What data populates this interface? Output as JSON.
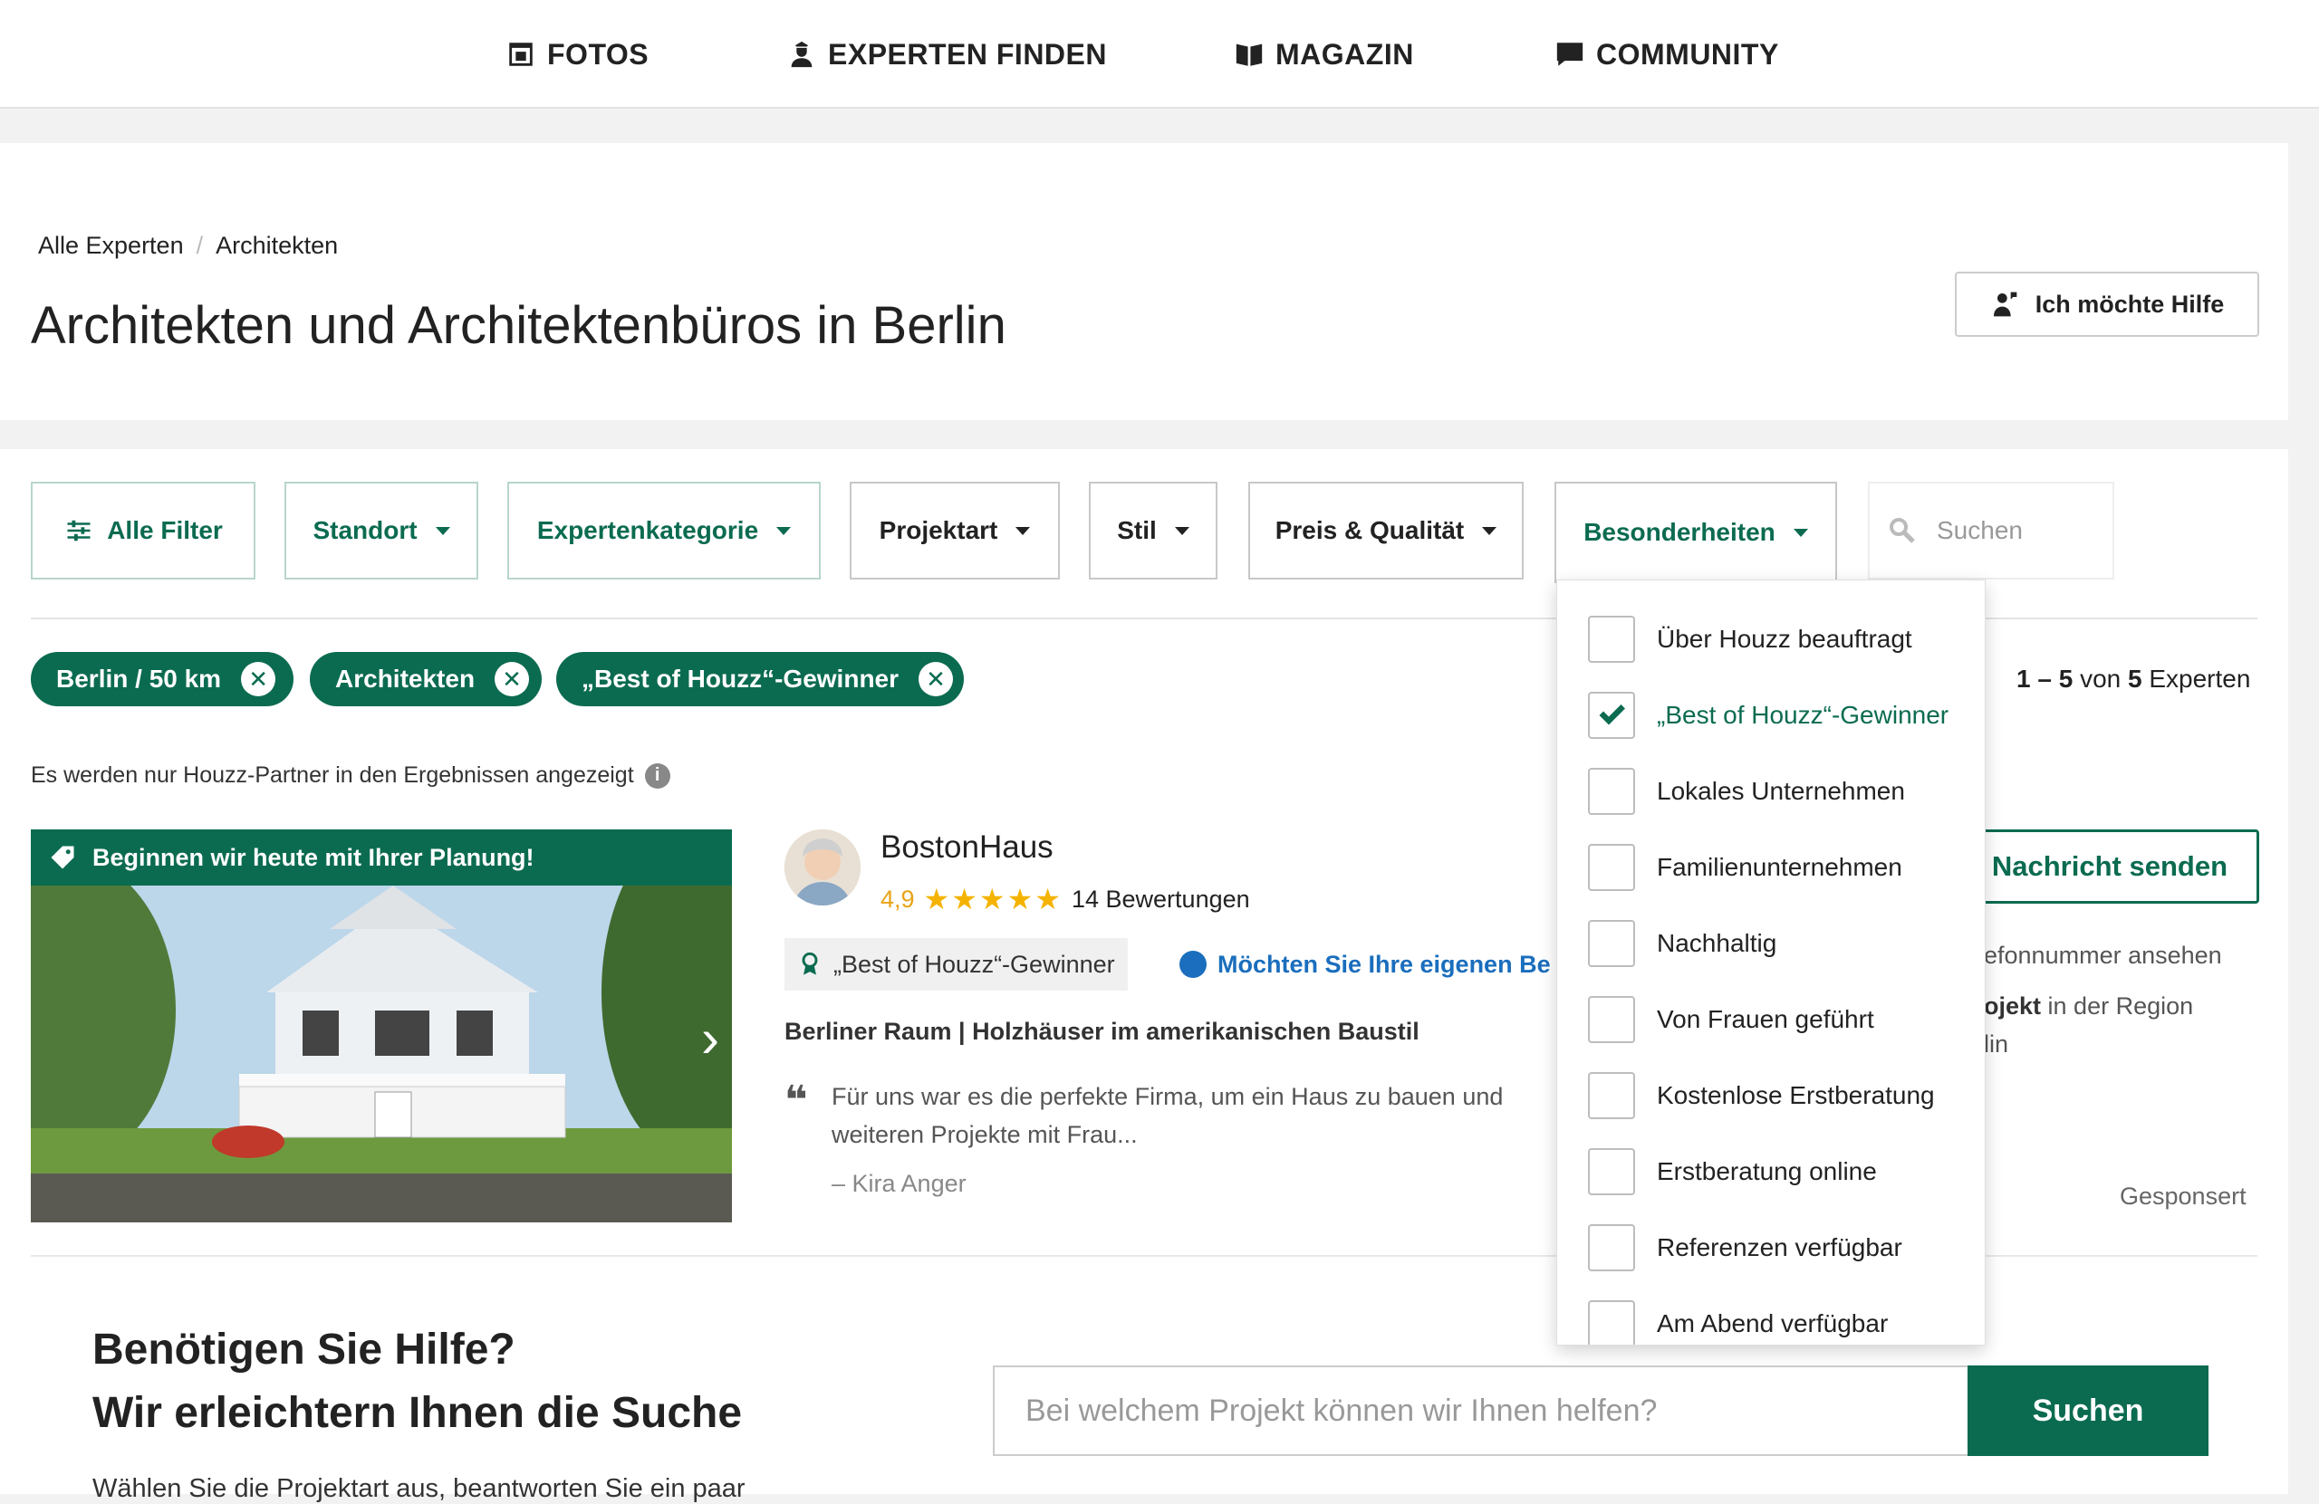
{
  "nav": {
    "items": [
      {
        "label": "FOTOS",
        "icon": "photo-icon"
      },
      {
        "label": "EXPERTEN FINDEN",
        "icon": "expert-icon"
      },
      {
        "label": "MAGAZIN",
        "icon": "book-icon"
      },
      {
        "label": "COMMUNITY",
        "icon": "chat-icon"
      }
    ]
  },
  "header": {
    "breadcrumb": [
      "Alle Experten",
      "/",
      "Architekten"
    ],
    "title": "Architekten und Architektenbüros in Berlin",
    "help_button": "Ich möchte Hilfe"
  },
  "filters": {
    "all_filters": "Alle Filter",
    "standort": "Standort",
    "kategorie": "Expertenkategorie",
    "projektart": "Projektart",
    "stil": "Stil",
    "preis": "Preis & Qualität",
    "besonderheiten": "Besonderheiten",
    "search_placeholder": "Suchen"
  },
  "chips": [
    "Berlin / 50 km",
    "Architekten",
    "„Best of Houzz“-Gewinner"
  ],
  "results": {
    "range": "1 – 5",
    "of_word": "von",
    "total": "5",
    "unit": "Experten",
    "partner_note": "Es werden nur Houzz-Partner in den Ergebnissen angezeigt"
  },
  "listing": {
    "banner": "Beginnen wir heute mit Ihrer Planung!",
    "name": "BostonHaus",
    "rating": "4,9",
    "stars": 5,
    "stars_display": "★★★★★",
    "reviews": "14 Bewertungen",
    "badge": "„Best of Houzz“-Gewinner",
    "badge_link": "Möchten Sie Ihre eigenen Be",
    "tagline": "Berliner Raum | Holzhäuser im amerikanischen Baustil",
    "quote_mark": "❝",
    "quote": "Für uns war es die perfekte Firma, um ein Haus zu bauen und weiteren Projekte mit Frau...",
    "quote_author": "– Kira Anger",
    "message_button": "Nachricht senden",
    "phone_text": "efonnummer ansehen",
    "project_bold": "ojekt",
    "project_rest": " in der Region",
    "region_cut": "lin",
    "sponsored": "Gesponsert"
  },
  "dropdown": {
    "options": [
      {
        "label": "Über Houzz beauftragt",
        "checked": false
      },
      {
        "label": "„Best of Houzz“-Gewinner",
        "checked": true
      },
      {
        "label": "Lokales Unternehmen",
        "checked": false
      },
      {
        "label": "Familienunternehmen",
        "checked": false
      },
      {
        "label": "Nachhaltig",
        "checked": false
      },
      {
        "label": "Von Frauen geführt",
        "checked": false
      },
      {
        "label": "Kostenlose Erstberatung",
        "checked": false
      },
      {
        "label": "Erstberatung online",
        "checked": false
      },
      {
        "label": "Referenzen verfügbar",
        "checked": false
      },
      {
        "label": "Am Abend verfügbar",
        "checked": false
      }
    ]
  },
  "help_section": {
    "title_line1": "Benötigen Sie Hilfe?",
    "title_line2": "Wir erleichtern Ihnen die Suche",
    "subtitle": "Wählen Sie die Projektart aus, beantworten Sie ein paar",
    "input_placeholder": "Bei welchem Projekt können wir Ihnen helfen?",
    "search_button": "Suchen"
  },
  "colors": {
    "brand_green": "#0b6b50",
    "star_yellow": "#f5b301",
    "link_blue": "#1a6ebd"
  }
}
